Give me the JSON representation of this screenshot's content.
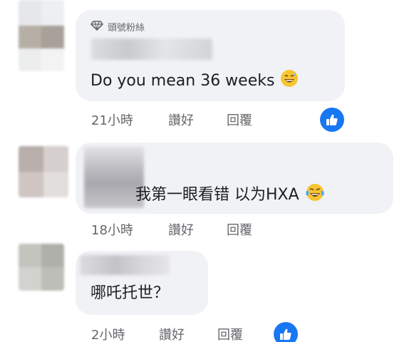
{
  "badge": {
    "label": "頭號粉絲",
    "icon": "diamond-icon"
  },
  "comments": [
    {
      "text": "Do you mean 36 weeks",
      "emoji": "grinning-sweat-emoji",
      "time": "21小時",
      "like_label": "讚好",
      "reply_label": "回覆",
      "reaction": "like-icon"
    },
    {
      "text": "我第一眼看错 以为HXA",
      "emoji": "tears-of-joy-emoji",
      "time": "18小時",
      "like_label": "讚好",
      "reply_label": "回覆"
    },
    {
      "text": "哪吒托世？",
      "time": "2小時",
      "like_label": "讚好",
      "reply_label": "回覆",
      "reaction": "like-icon"
    }
  ],
  "colors": {
    "bubble": "#f0f2f5",
    "meta_text": "#65676b",
    "like_blue": "#1877f2"
  }
}
